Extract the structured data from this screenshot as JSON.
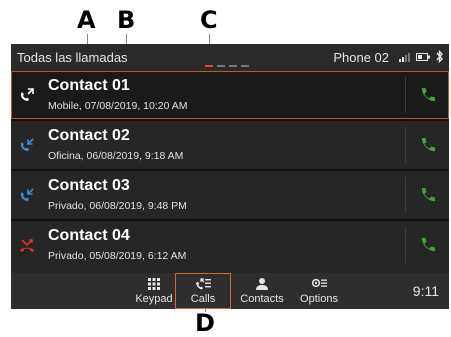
{
  "callouts": {
    "a": "A",
    "b": "B",
    "c": "C",
    "d": "D"
  },
  "topbar": {
    "title": "Todas las llamadas",
    "phone_name": "Phone 02",
    "page_dots": 4,
    "active_dot_color": "#e0452b"
  },
  "calls": [
    {
      "name": "Contact 01",
      "detail": "Mobile, 07/08/2019, 10:20 AM",
      "direction": "outgoing",
      "selected": true
    },
    {
      "name": "Contact 02",
      "detail": "Oficina, 06/08/2019, 9:18 AM",
      "direction": "incoming",
      "selected": false
    },
    {
      "name": "Contact 03",
      "detail": "Privado, 06/08/2019, 9:48 PM",
      "direction": "incoming",
      "selected": false
    },
    {
      "name": "Contact 04",
      "detail": "Privado, 05/08/2019, 6:12 AM",
      "direction": "missed",
      "selected": false
    }
  ],
  "bottombar": {
    "tabs": [
      {
        "label": "Keypad",
        "icon": "keypad-icon"
      },
      {
        "label": "Calls",
        "icon": "calls-icon",
        "active": true
      },
      {
        "label": "Contacts",
        "icon": "contacts-icon"
      },
      {
        "label": "Options",
        "icon": "options-icon"
      }
    ],
    "clock": "9:11"
  },
  "colors": {
    "call_green": "#3fa535",
    "incoming_blue": "#3b8ed8",
    "missed_red": "#e0302b",
    "accent_orange": "#d06a3a"
  }
}
